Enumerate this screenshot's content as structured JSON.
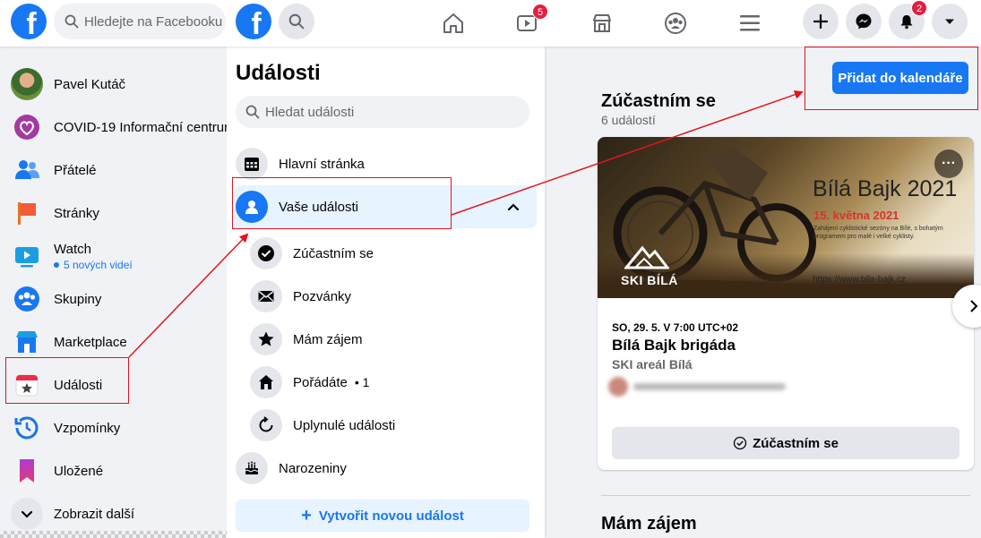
{
  "topbar": {
    "logo_letter": "f",
    "search_placeholder": "Hledejte na Facebooku",
    "watch_badge": "5",
    "notifications_badge": "2"
  },
  "sidebar": {
    "items": [
      {
        "label": "Pavel Kutáč",
        "icon": "avatar"
      },
      {
        "label": "COVID-19 Informační centrum",
        "icon": "covid-heart-icon"
      },
      {
        "label": "Přátelé",
        "icon": "friends-icon"
      },
      {
        "label": "Stránky",
        "icon": "flag-icon"
      },
      {
        "label": "Watch",
        "sub": "5 nových videí",
        "icon": "watch-icon"
      },
      {
        "label": "Skupiny",
        "icon": "groups-icon"
      },
      {
        "label": "Marketplace",
        "icon": "marketplace-icon"
      },
      {
        "label": "Události",
        "icon": "events-calendar-icon"
      },
      {
        "label": "Vzpomínky",
        "icon": "memories-clock-icon"
      },
      {
        "label": "Uložené",
        "icon": "saved-bookmark-icon"
      },
      {
        "label": "Zobrazit další",
        "icon": "chevron-down-icon"
      }
    ]
  },
  "events_panel": {
    "title": "Události",
    "search_placeholder": "Hledat události",
    "items": [
      {
        "label": "Hlavní stránka",
        "icon": "calendar-grid-icon"
      },
      {
        "label": "Vaše události",
        "icon": "person-icon"
      },
      {
        "label": "Zúčastním se",
        "icon": "check-circle-icon"
      },
      {
        "label": "Pozvánky",
        "icon": "envelope-icon"
      },
      {
        "label": "Mám zájem",
        "icon": "star-icon"
      },
      {
        "label": "Pořádáte",
        "count": "• 1",
        "icon": "house-icon"
      },
      {
        "label": "Uplynulé události",
        "icon": "history-icon"
      },
      {
        "label": "Narozeniny",
        "icon": "cake-icon"
      }
    ],
    "create_label": "Vytvořit novou událost",
    "create_plus": "+"
  },
  "main": {
    "add_calendar_label": "Přidat do kalendáře",
    "section_title": "Zúčastním se",
    "section_count": "6 událostí",
    "card": {
      "banner_title": "Bílá Bajk 2021",
      "banner_date": "15. května 2021",
      "banner_tagline": "Zahájení cyklistické sezóny na Bílé, s bohatým programem pro malé i velké cyklisty.",
      "banner_url": "https://www.bila-bajk.cz",
      "banner_brand": "SKI BÍLÁ",
      "more_label": "···",
      "date": "SO, 29. 5. V 7:00 UTC+02",
      "name": "Bílá Bajk brigáda",
      "location": "SKI areál Bílá",
      "going_button": "Zúčastním se"
    },
    "next_section_title": "Mám zájem"
  },
  "colors": {
    "accent": "#1877f2",
    "annotation": "#e3141d",
    "badge": "#e41e3f"
  }
}
